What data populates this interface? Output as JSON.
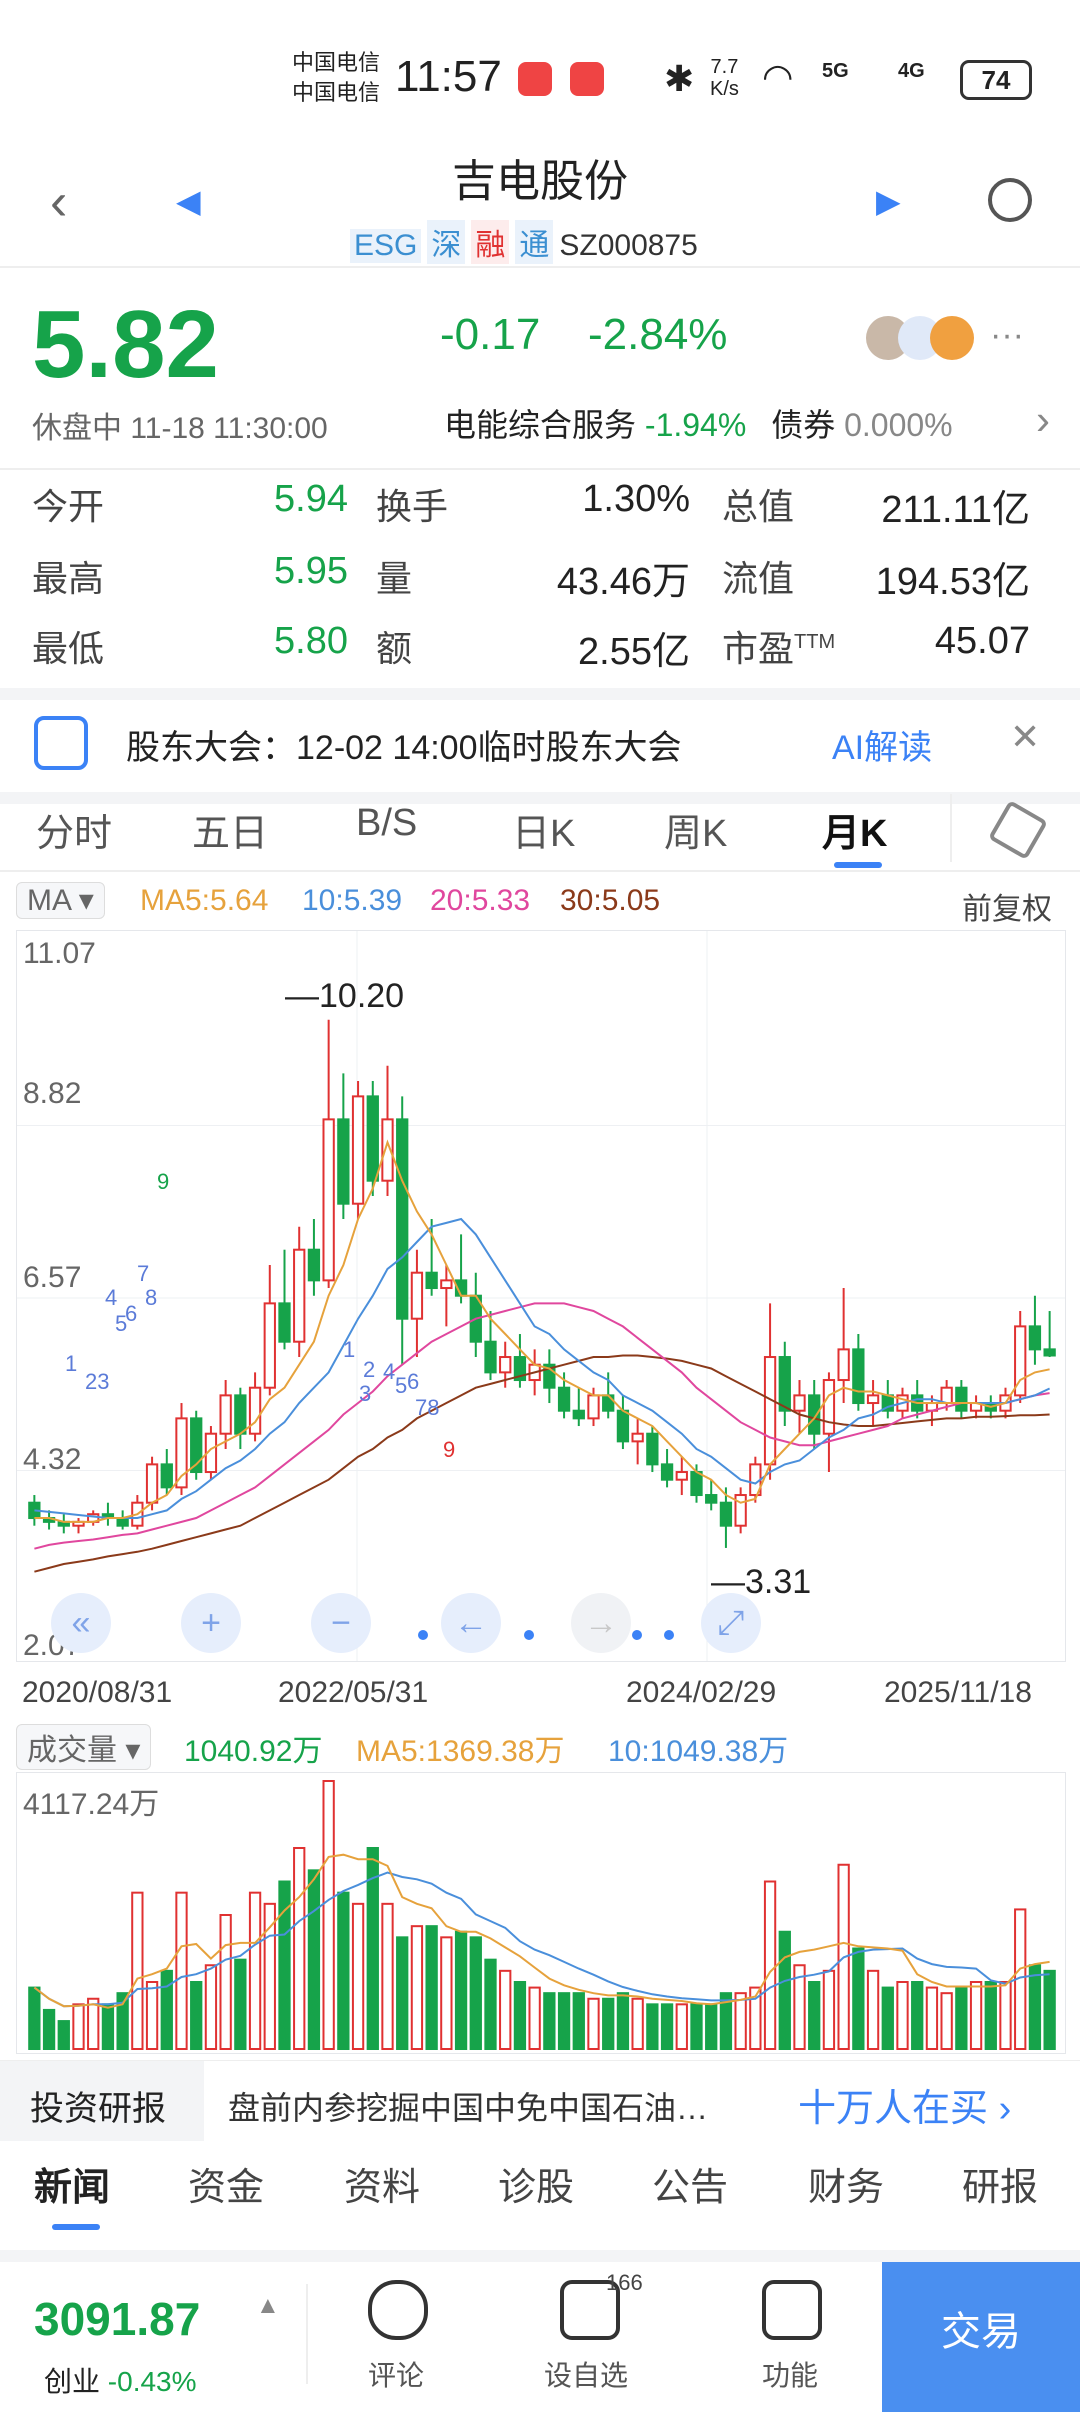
{
  "status_bar": {
    "carrier1": "中国电信",
    "carrier2": "中国电信",
    "time": "11:57",
    "net_speed_top": "7.7",
    "net_speed_bottom": "K/s",
    "signal1": "5G",
    "signal2": "4G",
    "battery": "74"
  },
  "header": {
    "title": "吉电股份",
    "tags": [
      "ESG",
      "深",
      "融",
      "通"
    ],
    "code": "SZ000875"
  },
  "quote": {
    "price": "5.82",
    "change": "-0.17",
    "change_pct": "-2.84%",
    "status": "休盘中 11-18 11:30:00",
    "sector_name": "电能综合服务",
    "sector_pct": "-1.94%",
    "bond_label": "债券",
    "bond_pct": "0.000%",
    "more": "···"
  },
  "stats": [
    {
      "l1": "今开",
      "v1": "5.94",
      "l2": "换手",
      "v2": "1.30%",
      "l3": "总值",
      "v3": "211.11亿"
    },
    {
      "l1": "最高",
      "v1": "5.95",
      "l2": "量",
      "v2": "43.46万",
      "l3": "流值",
      "v3": "194.53亿"
    },
    {
      "l1": "最低",
      "v1": "5.80",
      "l2": "额",
      "v2": "2.55亿",
      "l3": "市盈",
      "l3sup": "TTM",
      "v3": "45.07"
    }
  ],
  "banner": {
    "text": "股东大会：12-02 14:00临时股东大会",
    "action": "AI解读",
    "close": "✕"
  },
  "chart_tabs": [
    "分时",
    "五日",
    "B/S",
    "日K",
    "周K",
    "月K"
  ],
  "chart_tab_active": "月K",
  "ma_bar": {
    "selector": "MA",
    "ma5": "MA5:5.64",
    "ma10": "10:5.39",
    "ma20": "20:5.33",
    "ma30": "30:5.05",
    "adjust": "前复权",
    "colors": {
      "ma5": "#e6a23c",
      "ma10": "#4a8fdb",
      "ma20": "#e0479e",
      "ma30": "#8b3a1a",
      "up": "#e03131",
      "down": "#16a34a"
    }
  },
  "chart_data": {
    "type": "candlestick",
    "y_ticks": [
      "11.07",
      "8.82",
      "6.57",
      "4.32",
      "2.07"
    ],
    "ylim": [
      2.07,
      11.07
    ],
    "x_ticks": [
      "2020/08/31",
      "2022/05/31",
      "2024/02/29",
      "2025/11/18"
    ],
    "high_marker": "10.20",
    "low_marker": "3.31",
    "ohlc": [
      [
        3.9,
        4.0,
        3.6,
        3.7
      ],
      [
        3.7,
        3.8,
        3.55,
        3.65
      ],
      [
        3.65,
        3.75,
        3.5,
        3.6
      ],
      [
        3.6,
        3.7,
        3.5,
        3.65
      ],
      [
        3.65,
        3.8,
        3.6,
        3.75
      ],
      [
        3.75,
        3.9,
        3.6,
        3.7
      ],
      [
        3.7,
        3.8,
        3.55,
        3.6
      ],
      [
        3.6,
        4.0,
        3.55,
        3.9
      ],
      [
        3.9,
        4.5,
        3.8,
        4.4
      ],
      [
        4.4,
        4.6,
        4.0,
        4.1
      ],
      [
        4.1,
        5.2,
        4.0,
        5.0
      ],
      [
        5.0,
        5.1,
        4.2,
        4.3
      ],
      [
        4.3,
        4.9,
        4.2,
        4.8
      ],
      [
        4.8,
        5.5,
        4.6,
        5.3
      ],
      [
        5.3,
        5.4,
        4.6,
        4.8
      ],
      [
        4.8,
        5.6,
        4.7,
        5.4
      ],
      [
        5.4,
        7.0,
        5.3,
        6.5
      ],
      [
        6.5,
        7.2,
        5.9,
        6.0
      ],
      [
        6.0,
        7.5,
        5.8,
        7.2
      ],
      [
        7.2,
        7.6,
        6.6,
        6.8
      ],
      [
        6.8,
        10.2,
        6.7,
        8.9
      ],
      [
        8.9,
        9.5,
        7.6,
        7.8
      ],
      [
        7.8,
        9.4,
        7.6,
        9.2
      ],
      [
        9.2,
        9.4,
        7.9,
        8.1
      ],
      [
        8.1,
        9.6,
        7.9,
        8.9
      ],
      [
        8.9,
        9.2,
        5.7,
        6.3
      ],
      [
        6.3,
        7.2,
        5.8,
        6.9
      ],
      [
        6.9,
        7.6,
        6.6,
        6.7
      ],
      [
        6.7,
        7.0,
        6.2,
        6.8
      ],
      [
        6.8,
        7.4,
        6.5,
        6.6
      ],
      [
        6.6,
        6.9,
        5.8,
        6.0
      ],
      [
        6.0,
        6.4,
        5.5,
        5.6
      ],
      [
        5.6,
        6.0,
        5.4,
        5.8
      ],
      [
        5.8,
        6.1,
        5.4,
        5.5
      ],
      [
        5.5,
        5.9,
        5.3,
        5.7
      ],
      [
        5.7,
        5.9,
        5.2,
        5.4
      ],
      [
        5.4,
        5.6,
        5.0,
        5.1
      ],
      [
        5.1,
        5.4,
        4.9,
        5.0
      ],
      [
        5.0,
        5.4,
        4.9,
        5.3
      ],
      [
        5.3,
        5.6,
        5.0,
        5.1
      ],
      [
        5.1,
        5.3,
        4.6,
        4.7
      ],
      [
        4.7,
        5.0,
        4.4,
        4.8
      ],
      [
        4.8,
        4.9,
        4.3,
        4.4
      ],
      [
        4.4,
        4.6,
        4.1,
        4.2
      ],
      [
        4.2,
        4.5,
        4.0,
        4.3
      ],
      [
        4.3,
        4.4,
        3.9,
        4.0
      ],
      [
        4.0,
        4.2,
        3.8,
        3.9
      ],
      [
        3.9,
        4.1,
        3.31,
        3.6
      ],
      [
        3.6,
        4.1,
        3.5,
        4.0
      ],
      [
        4.0,
        4.5,
        3.9,
        4.4
      ],
      [
        4.4,
        6.5,
        4.2,
        5.8
      ],
      [
        5.8,
        6.0,
        4.9,
        5.1
      ],
      [
        5.1,
        5.5,
        4.8,
        5.3
      ],
      [
        5.3,
        5.5,
        4.6,
        4.8
      ],
      [
        4.8,
        5.6,
        4.3,
        5.5
      ],
      [
        5.5,
        6.7,
        5.2,
        5.9
      ],
      [
        5.9,
        6.1,
        5.1,
        5.2
      ],
      [
        5.2,
        5.5,
        4.9,
        5.3
      ],
      [
        5.3,
        5.5,
        5.0,
        5.1
      ],
      [
        5.1,
        5.4,
        5.0,
        5.3
      ],
      [
        5.3,
        5.5,
        5.0,
        5.1
      ],
      [
        5.1,
        5.3,
        4.9,
        5.2
      ],
      [
        5.2,
        5.5,
        5.1,
        5.4
      ],
      [
        5.4,
        5.5,
        5.0,
        5.1
      ],
      [
        5.1,
        5.3,
        5.0,
        5.2
      ],
      [
        5.2,
        5.3,
        5.0,
        5.1
      ],
      [
        5.1,
        5.4,
        5.0,
        5.3
      ],
      [
        5.3,
        6.4,
        5.2,
        6.2
      ],
      [
        6.2,
        6.6,
        5.7,
        5.9
      ],
      [
        5.9,
        6.4,
        5.8,
        5.82
      ]
    ],
    "ma_lines": {
      "ma5": [
        3.7,
        3.7,
        3.65,
        3.65,
        3.65,
        3.7,
        3.7,
        3.75,
        3.9,
        4.0,
        4.25,
        4.4,
        4.6,
        4.7,
        4.8,
        4.95,
        5.25,
        5.4,
        5.7,
        6.0,
        6.6,
        7.0,
        7.6,
        8.0,
        8.6,
        8.1,
        7.7,
        7.4,
        7.0,
        6.6,
        6.6,
        6.3,
        6.1,
        5.9,
        5.7,
        5.65,
        5.5,
        5.4,
        5.3,
        5.3,
        5.1,
        5.0,
        4.9,
        4.7,
        4.5,
        4.3,
        4.2,
        4.0,
        3.9,
        3.95,
        4.4,
        4.6,
        4.8,
        5.0,
        5.3,
        5.4,
        5.35,
        5.35,
        5.3,
        5.25,
        5.2,
        5.2,
        5.2,
        5.2,
        5.2,
        5.15,
        5.2,
        5.5,
        5.6,
        5.64
      ],
      "ma10": [
        3.8,
        3.78,
        3.76,
        3.74,
        3.72,
        3.7,
        3.7,
        3.7,
        3.75,
        3.8,
        3.95,
        4.05,
        4.2,
        4.35,
        4.45,
        4.6,
        4.8,
        4.95,
        5.2,
        5.4,
        5.6,
        5.95,
        6.3,
        6.6,
        6.95,
        7.1,
        7.3,
        7.5,
        7.55,
        7.6,
        7.4,
        7.1,
        6.8,
        6.5,
        6.2,
        6.1,
        5.9,
        5.75,
        5.6,
        5.5,
        5.3,
        5.2,
        5.1,
        4.95,
        4.8,
        4.6,
        4.5,
        4.35,
        4.2,
        4.15,
        4.3,
        4.4,
        4.45,
        4.6,
        4.75,
        4.85,
        5.0,
        5.05,
        5.15,
        5.2,
        5.25,
        5.25,
        5.2,
        5.2,
        5.2,
        5.2,
        5.2,
        5.25,
        5.3,
        5.39
      ],
      "ma20": [
        3.3,
        3.35,
        3.38,
        3.4,
        3.42,
        3.45,
        3.48,
        3.5,
        3.55,
        3.6,
        3.65,
        3.7,
        3.8,
        3.9,
        4.0,
        4.1,
        4.25,
        4.4,
        4.55,
        4.7,
        4.85,
        5.05,
        5.2,
        5.35,
        5.55,
        5.7,
        5.85,
        6.0,
        6.1,
        6.2,
        6.3,
        6.35,
        6.4,
        6.45,
        6.5,
        6.5,
        6.5,
        6.45,
        6.4,
        6.3,
        6.2,
        6.05,
        5.9,
        5.75,
        5.6,
        5.4,
        5.25,
        5.1,
        4.95,
        4.85,
        4.75,
        4.7,
        4.65,
        4.65,
        4.7,
        4.75,
        4.8,
        4.85,
        4.9,
        5.0,
        5.05,
        5.1,
        5.15,
        5.2,
        5.2,
        5.2,
        5.2,
        5.25,
        5.3,
        5.33
      ],
      "ma30": [
        3.0,
        3.05,
        3.1,
        3.13,
        3.16,
        3.2,
        3.23,
        3.26,
        3.3,
        3.35,
        3.4,
        3.45,
        3.5,
        3.55,
        3.6,
        3.7,
        3.8,
        3.9,
        4.0,
        4.1,
        4.2,
        4.35,
        4.5,
        4.6,
        4.75,
        4.85,
        5.0,
        5.1,
        5.2,
        5.3,
        5.4,
        5.45,
        5.5,
        5.55,
        5.6,
        5.65,
        5.7,
        5.75,
        5.8,
        5.8,
        5.82,
        5.82,
        5.8,
        5.78,
        5.75,
        5.7,
        5.65,
        5.55,
        5.45,
        5.35,
        5.25,
        5.15,
        5.05,
        5.0,
        4.95,
        4.92,
        4.9,
        4.9,
        4.92,
        4.94,
        4.96,
        4.98,
        5.0,
        5.0,
        5.02,
        5.02,
        5.03,
        5.04,
        5.04,
        5.05
      ]
    },
    "hints_up": [
      "1",
      "23",
      "4",
      "5",
      "6",
      "7",
      "8",
      "9"
    ],
    "hints_down": [
      "1",
      "2",
      "3",
      "4",
      "5",
      "6",
      "78",
      "9"
    ]
  },
  "volume": {
    "selector": "成交量",
    "vol": "1040.92万",
    "ma5": "MA5:1369.38万",
    "ma10": "10:1049.38万",
    "max_label": "4117.24万",
    "values": [
      11,
      7,
      5,
      8,
      9,
      8,
      10,
      28,
      12,
      14,
      28,
      12,
      15,
      24,
      16,
      28,
      26,
      30,
      36,
      32,
      48,
      28,
      26,
      36,
      26,
      20,
      22,
      22,
      20,
      21,
      20,
      16,
      14,
      12,
      11,
      10,
      10,
      10,
      9,
      9,
      10,
      9,
      8,
      8,
      8,
      8,
      8,
      10,
      10,
      11,
      30,
      21,
      15,
      12,
      14,
      33,
      18,
      14,
      11,
      12,
      12,
      11,
      10,
      11,
      12,
      12,
      12,
      25,
      15,
      14
    ]
  },
  "research": {
    "label": "投资研报",
    "text": "盘前内参挖掘中国中免中国石油…",
    "action": "十万人在买"
  },
  "news_tabs": [
    "新闻",
    "资金",
    "资料",
    "诊股",
    "公告",
    "财务",
    "研报"
  ],
  "bottom": {
    "index_value": "3091.87",
    "index_name": "创业",
    "index_pct": "-0.43%",
    "comment": "评论",
    "watchlist": "设自选",
    "watch_badge": "166",
    "function": "功能",
    "trade": "交易"
  }
}
